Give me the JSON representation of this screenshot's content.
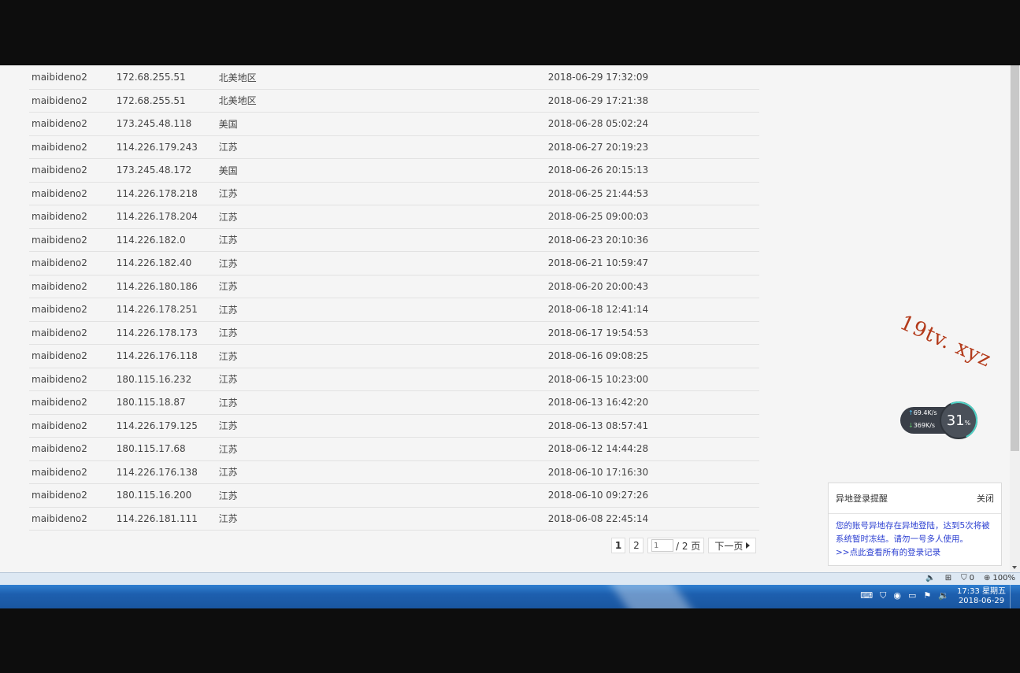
{
  "records": [
    {
      "user": "maibideno2",
      "ip": "172.68.255.51",
      "location": "北美地区",
      "time": "2018-06-29 17:32:09"
    },
    {
      "user": "maibideno2",
      "ip": "172.68.255.51",
      "location": "北美地区",
      "time": "2018-06-29 17:21:38"
    },
    {
      "user": "maibideno2",
      "ip": "173.245.48.118",
      "location": "美国",
      "time": "2018-06-28 05:02:24"
    },
    {
      "user": "maibideno2",
      "ip": "114.226.179.243",
      "location": "江苏",
      "time": "2018-06-27 20:19:23"
    },
    {
      "user": "maibideno2",
      "ip": "173.245.48.172",
      "location": "美国",
      "time": "2018-06-26 20:15:13"
    },
    {
      "user": "maibideno2",
      "ip": "114.226.178.218",
      "location": "江苏",
      "time": "2018-06-25 21:44:53"
    },
    {
      "user": "maibideno2",
      "ip": "114.226.178.204",
      "location": "江苏",
      "time": "2018-06-25 09:00:03"
    },
    {
      "user": "maibideno2",
      "ip": "114.226.182.0",
      "location": "江苏",
      "time": "2018-06-23 20:10:36"
    },
    {
      "user": "maibideno2",
      "ip": "114.226.182.40",
      "location": "江苏",
      "time": "2018-06-21 10:59:47"
    },
    {
      "user": "maibideno2",
      "ip": "114.226.180.186",
      "location": "江苏",
      "time": "2018-06-20 20:00:43"
    },
    {
      "user": "maibideno2",
      "ip": "114.226.178.251",
      "location": "江苏",
      "time": "2018-06-18 12:41:14"
    },
    {
      "user": "maibideno2",
      "ip": "114.226.178.173",
      "location": "江苏",
      "time": "2018-06-17 19:54:53"
    },
    {
      "user": "maibideno2",
      "ip": "114.226.176.118",
      "location": "江苏",
      "time": "2018-06-16 09:08:25"
    },
    {
      "user": "maibideno2",
      "ip": "180.115.16.232",
      "location": "江苏",
      "time": "2018-06-15 10:23:00"
    },
    {
      "user": "maibideno2",
      "ip": "180.115.18.87",
      "location": "江苏",
      "time": "2018-06-13 16:42:20"
    },
    {
      "user": "maibideno2",
      "ip": "114.226.179.125",
      "location": "江苏",
      "time": "2018-06-13 08:57:41"
    },
    {
      "user": "maibideno2",
      "ip": "180.115.17.68",
      "location": "江苏",
      "time": "2018-06-12 14:44:28"
    },
    {
      "user": "maibideno2",
      "ip": "114.226.176.138",
      "location": "江苏",
      "time": "2018-06-10 17:16:30"
    },
    {
      "user": "maibideno2",
      "ip": "180.115.16.200",
      "location": "江苏",
      "time": "2018-06-10 09:27:26"
    },
    {
      "user": "maibideno2",
      "ip": "114.226.181.111",
      "location": "江苏",
      "time": "2018-06-08 22:45:14"
    }
  ],
  "pagination": {
    "page1": "1",
    "page2": "2",
    "input_placeholder": "1",
    "total": "/ 2 页",
    "next_label": "下一页"
  },
  "watermark": "19tv. xyz",
  "speed_widget": {
    "upload": "69.4K/s",
    "download": "369K/s",
    "percent": "31",
    "percent_unit": "%"
  },
  "alert": {
    "title": "异地登录提醒",
    "close": "关闭",
    "message": "您的账号异地存在异地登陆，达到5次将被系统暂时冻结。请勿一号多人使用。",
    "link": ">>点此查看所有的登录记录"
  },
  "statusbar": {
    "shield_count": "0",
    "zoom": "100%"
  },
  "taskbar": {
    "time": "17:33 星期五",
    "date": "2018-06-29"
  },
  "colors": {
    "link_blue": "#2b3fd1",
    "watermark_red": "#b33a1a",
    "taskbar_blue": "#1d5fae"
  }
}
